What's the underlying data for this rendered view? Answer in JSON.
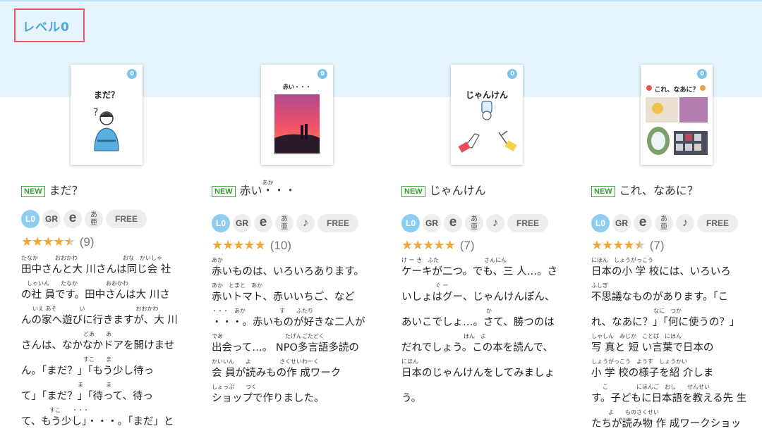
{
  "section": {
    "level_label": "レベル0"
  },
  "books": [
    {
      "cover_title": "まだ？",
      "cover_badge": "0",
      "new_label": "NEW",
      "title": "まだ？",
      "title_ruby": "",
      "icons": {
        "level": "L0",
        "gr": "GR",
        "e": "e",
        "jp": "あ\n亜",
        "music": "",
        "free": "FREE"
      },
      "rating": {
        "stars": 4.5,
        "count": "(9)"
      },
      "desc_lines": [
        {
          "ruby": "たなか　　　おおかわ　　　　　　　　おな　かいしゃ",
          "text": "田中さんと大 川さんは同じ会 社"
        },
        {
          "ruby": "　しゃいん　　たなか　　　　　おおかわ",
          "text": "の社 員です。田中さんは大 川さ"
        },
        {
          "ruby": "　　いえ あそ　　　　い　　　　　　　　　おおかわ",
          "text": "んの家へ遊びに行きますが、大 川"
        },
        {
          "ruby": "　　　　　　　　　　　どあ　　あ",
          "text": "さんは、なかなかドアを開けませ"
        },
        {
          "ruby": "　　　　　　　　　　　すこ　　ま",
          "text": "ん。「まだ？」「もう少し待っ"
        },
        {
          "ruby": "　　　　　　　　　　ま　　　　ま",
          "text": "て」「まだ？」「待って、待っ"
        },
        {
          "ruby": "　　　　　すこ　　・・・",
          "text": "て、もう少し」・・・。「まだ」と"
        }
      ]
    },
    {
      "cover_title": "赤い・・・",
      "cover_badge": "0",
      "new_label": "NEW",
      "title": "赤い・・・",
      "title_ruby": "あか",
      "icons": {
        "level": "L0",
        "gr": "GR",
        "e": "e",
        "jp": "あ\n亜",
        "music": "♪",
        "free": "FREE"
      },
      "rating": {
        "stars": 5,
        "count": "(10)"
      },
      "desc_lines": [
        {
          "ruby": "あか",
          "text": "赤いものは、いろいろあります。"
        },
        {
          "ruby": "あか　とまと　あか",
          "text": "赤いトマト、赤いいちご、など"
        },
        {
          "ruby": "・・・　あか　　　　　　す　　ふたり",
          "text": "・・・。赤いものが好きな二人が"
        },
        {
          "ruby": "であ　　　　　　　　　　　たげんごたどく",
          "text": "出会って…。 NPO多言語多読の"
        },
        {
          "ruby": "かいいん　　よ　　　　　さくせいわーく",
          "text": "会 員が読みもの作 成ワーク"
        },
        {
          "ruby": "しょっぷ　　つく",
          "text": "ショップで作りました。"
        }
      ]
    },
    {
      "cover_title": "じゃんけん",
      "cover_badge": "0",
      "new_label": "NEW",
      "title": "じゃんけん",
      "title_ruby": "",
      "icons": {
        "level": "L0",
        "gr": "GR",
        "e": "e",
        "jp": "あ\n亜",
        "music": "♪",
        "free": "FREE"
      },
      "rating": {
        "stars": 5,
        "count": "(7)"
      },
      "desc_lines": [
        {
          "ruby": "け ー き　ふた　　　　　　　　さんにん",
          "text": "ケーキが二つ。でも、三 人…。さ"
        },
        {
          "ruby": "　　　　　　ぐ ー",
          "text": "いしょはグー、じゃんけんぽん、"
        },
        {
          "ruby": "　　　　　　　　　　　　　　　か",
          "text": "あいこでしょ…。さて、勝つのは"
        },
        {
          "ruby": "　　　　　　　　　　　ほん　よ",
          "text": "だれでしょう。この本を読んで、"
        },
        {
          "ruby": "にほん",
          "text": "日本のじゃんけんをしてみましょ"
        },
        {
          "ruby": "",
          "text": "う。"
        }
      ]
    },
    {
      "cover_title": "これ、なあに？",
      "cover_badge": "0",
      "new_label": "NEW",
      "title": "これ、なあに？",
      "title_ruby": "",
      "icons": {
        "level": "L0",
        "gr": "GR",
        "e": "e",
        "jp": "あ\n亜",
        "music": "♪",
        "free": "FREE"
      },
      "rating": {
        "stars": 4.5,
        "count": "(7)"
      },
      "desc_lines": [
        {
          "ruby": "にほん　しょうがっこう",
          "text": "日本の小 学 校には、いろいろ"
        },
        {
          "ruby": "ふしぎ",
          "text": "不思議なものがあります。「こ"
        },
        {
          "ruby": "　　　　　　　　　　　なに　つか",
          "text": "れ、なあに？」「何に使うの？」"
        },
        {
          "ruby": "しゃしん　みじか　ことば　にほん",
          "text": "写 真と 短 い言葉で日本の"
        },
        {
          "ruby": "しょうがっこう　ようす　しょうかい",
          "text": "小 学 校の様子を紹 介しま"
        },
        {
          "ruby": "　　こ　　　　　にほんご　おし　　せんせい",
          "text": "す。子どもに日本語を教える先 生"
        },
        {
          "ruby": "　　　よ　　ものさくせい",
          "text": "たちが読み物 作 成ワークショッ"
        }
      ]
    }
  ]
}
